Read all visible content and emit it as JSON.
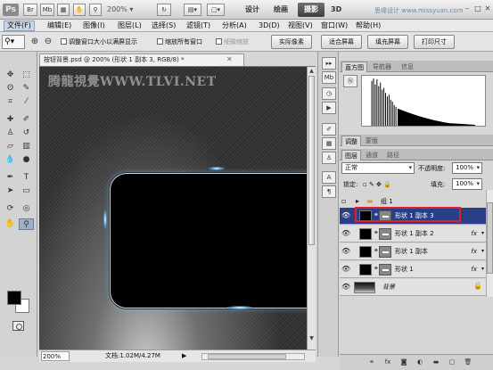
{
  "title_bar": {
    "app_logo": "Ps",
    "buttons": [
      "Br",
      "Mb"
    ],
    "zoom": "200%",
    "workspaces": [
      "设计",
      "绘画",
      "摄影",
      "3D"
    ],
    "active_workspace": "摄影",
    "watermark": "思缘设计 www.missyuan.com"
  },
  "menu": [
    "文件(F)",
    "编辑(E)",
    "图像(I)",
    "图层(L)",
    "选择(S)",
    "滤镜(T)",
    "分析(A)",
    "3D(D)",
    "视图(V)",
    "窗口(W)",
    "帮助(H)"
  ],
  "options": {
    "checkbox_resize": "调整窗口大小以满屏显示",
    "checkbox_zoom_all": "缩放所有窗口",
    "checkbox_scrubby": "细微缩放",
    "buttons": [
      "实际像素",
      "适合屏幕",
      "填充屏幕",
      "打印尺寸"
    ]
  },
  "document": {
    "tab_title": "按钮背景.psd @ 200% (形状 1 副本 3, RGB/8) *",
    "canvas_watermark": "腾龍視覺WWW.TLVI.NET",
    "status_zoom": "200%",
    "status_doc": "文档:1.02M/4.27M"
  },
  "panels": {
    "top_tabs": [
      "直方图",
      "导航器",
      "信息"
    ],
    "mid_tabs": [
      "调整",
      "蒙版"
    ],
    "layer_tabs": [
      "图层",
      "通道",
      "路径"
    ],
    "blend_mode": "正常",
    "opacity_label": "不透明度:",
    "opacity_value": "100%",
    "lock_label": "锁定:",
    "fill_label": "填充:",
    "fill_value": "100%",
    "group_name": "组 1",
    "layers": [
      {
        "name": "形状 1 副本 3",
        "selected": true
      },
      {
        "name": "形状 1 副本 2",
        "fx": "fx"
      },
      {
        "name": "形状 1 副本",
        "fx": "fx"
      },
      {
        "name": "形状 1",
        "fx": "fx"
      }
    ],
    "background_layer": "背景"
  },
  "colors": {
    "selected_layer": "#2a3f86",
    "highlight_box": "#e0202a"
  }
}
